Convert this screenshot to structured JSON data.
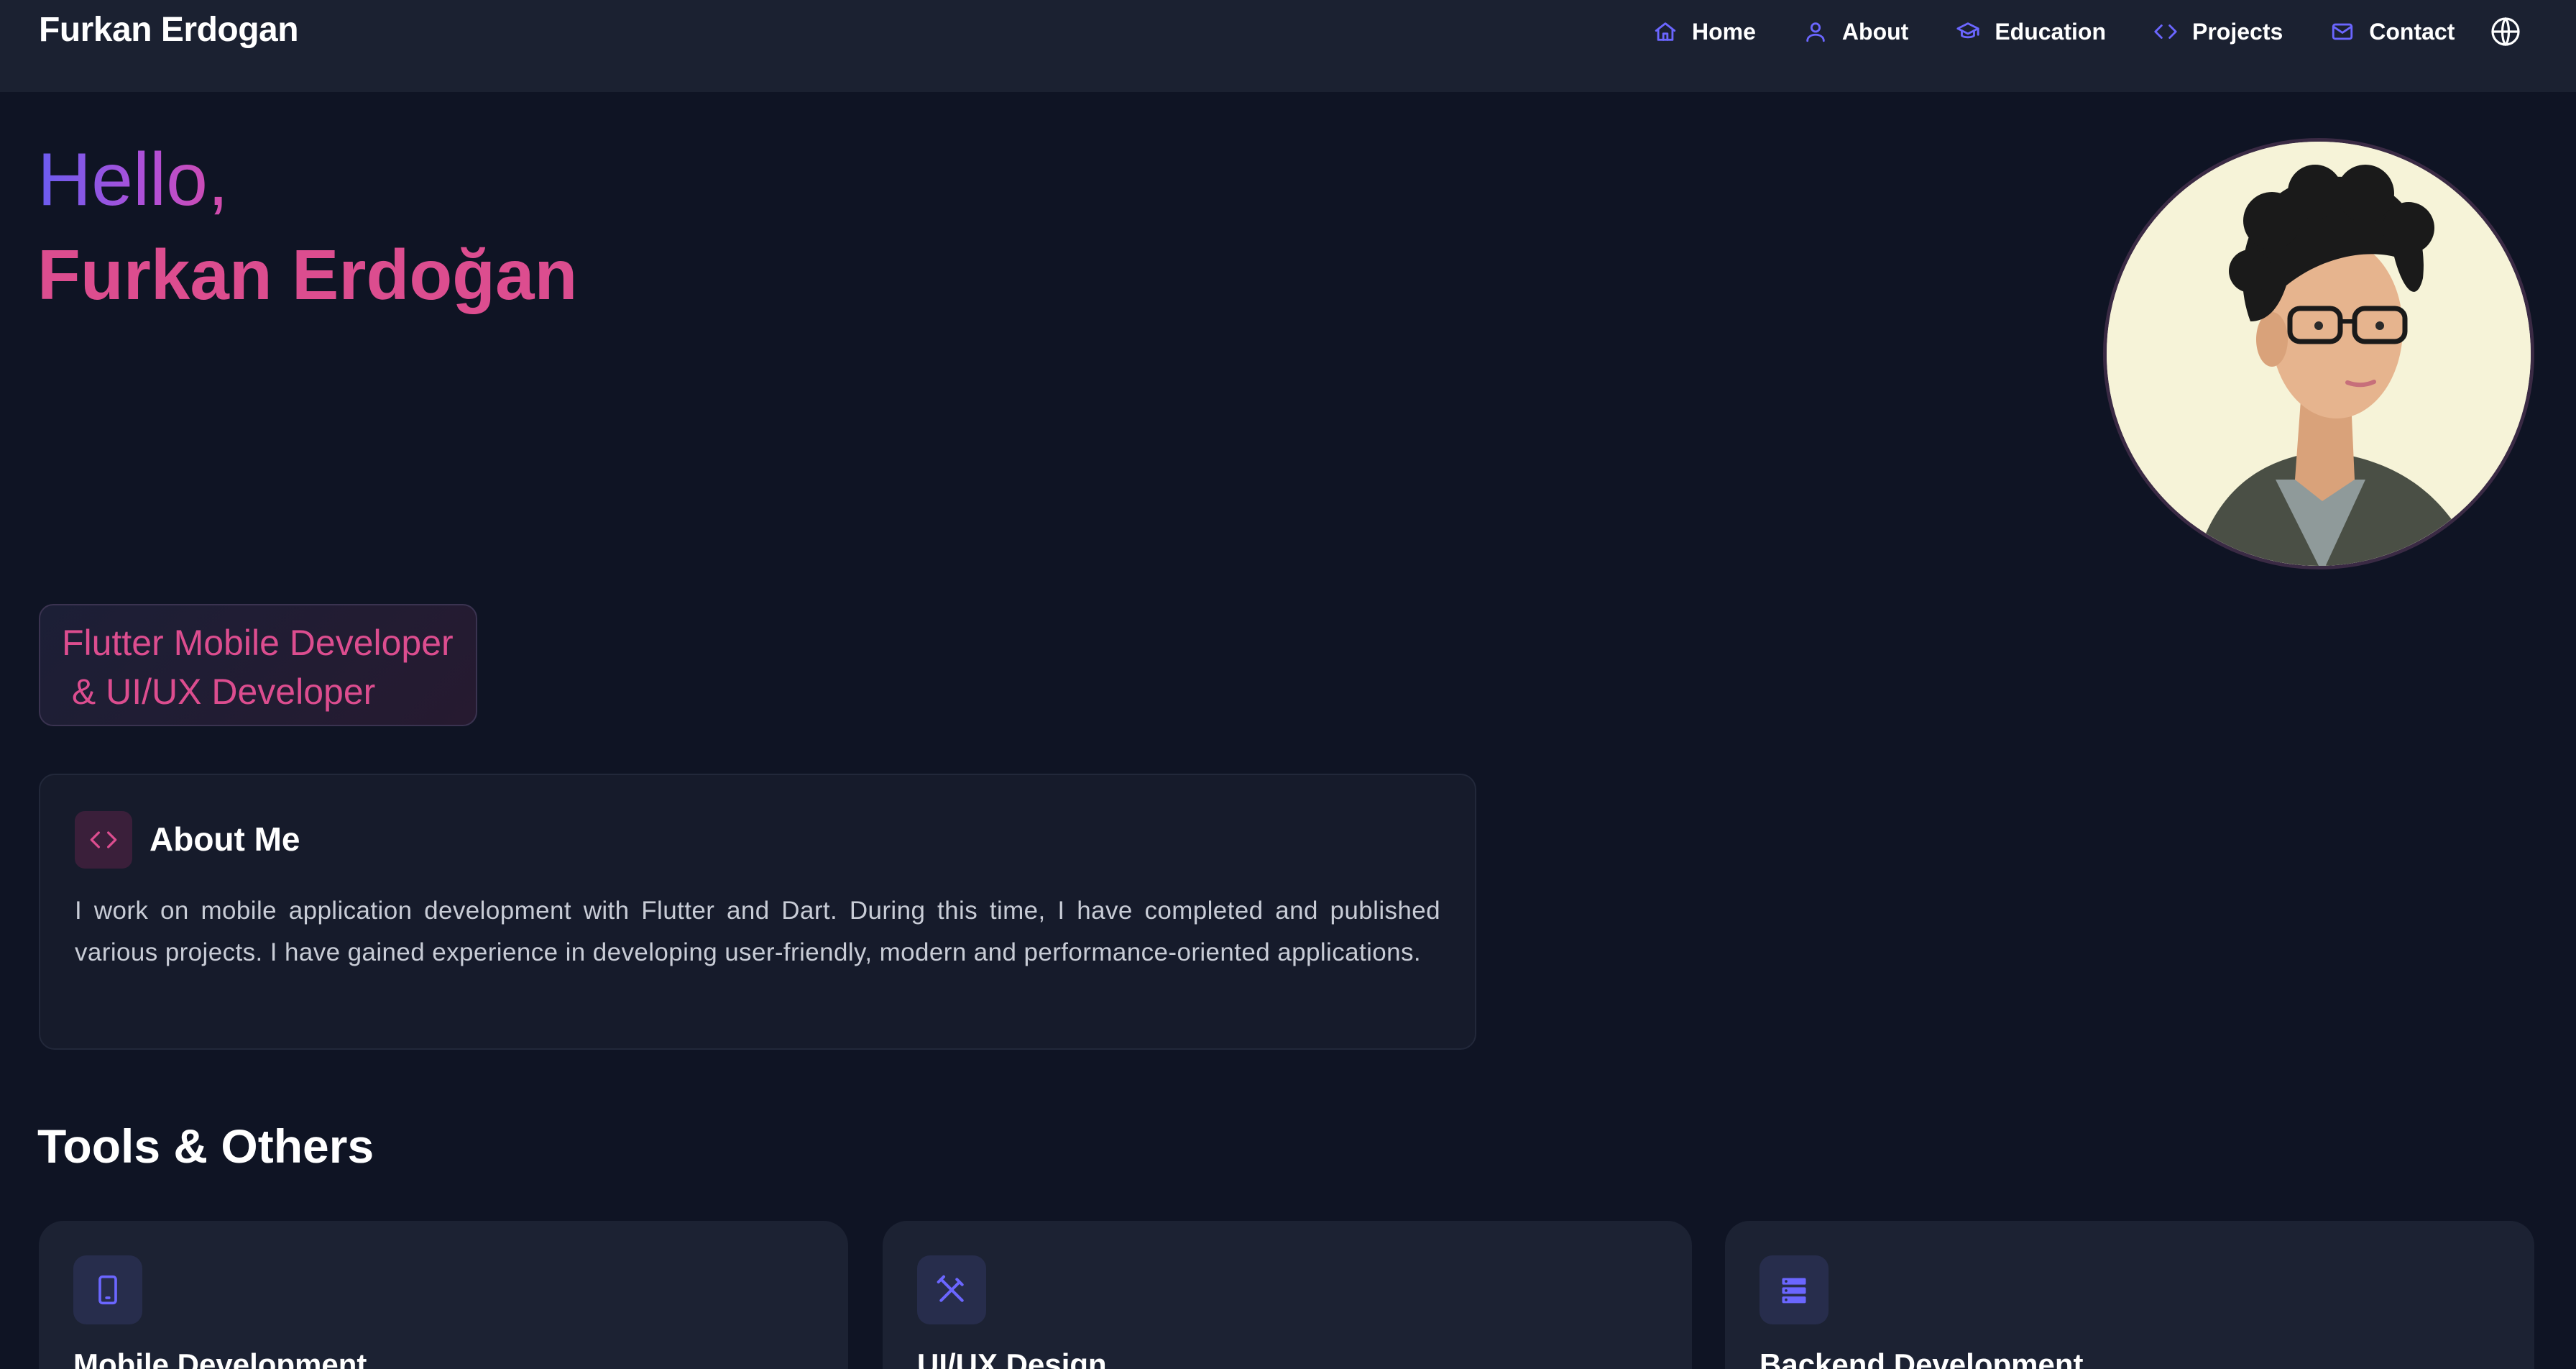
{
  "header": {
    "brand": "Furkan Erdogan",
    "nav": [
      {
        "label": "Home",
        "icon": "home-icon"
      },
      {
        "label": "About",
        "icon": "user-icon"
      },
      {
        "label": "Education",
        "icon": "graduation-cap-icon"
      },
      {
        "label": "Projects",
        "icon": "code-icon"
      },
      {
        "label": "Contact",
        "icon": "mail-icon"
      }
    ],
    "language_icon": "globe-icon"
  },
  "hero": {
    "greeting": "Hello,",
    "name": "Furkan Erdoğan",
    "role_line1": "Flutter Mobile Developer",
    "role_line2": " & UI/UX Developer"
  },
  "about": {
    "title": "About Me",
    "icon": "code-icon",
    "text": "I work on mobile application development with Flutter and Dart. During this time, I have completed and published various projects. I have gained experience in developing user-friendly, modern and performance-oriented applications."
  },
  "tools": {
    "title": "Tools & Others",
    "cards": [
      {
        "name": "Mobile Development",
        "icon": "smartphone-icon"
      },
      {
        "name": "UI/UX Design",
        "icon": "design-tools-icon"
      },
      {
        "name": "Backend Development",
        "icon": "server-icon"
      }
    ]
  },
  "colors": {
    "background": "#0f1424",
    "nav_bg": "#1b2131",
    "accent_pink": "#dc4d8f",
    "accent_purple": "#6a5cf0",
    "icon_blue": "#6b66ff"
  }
}
